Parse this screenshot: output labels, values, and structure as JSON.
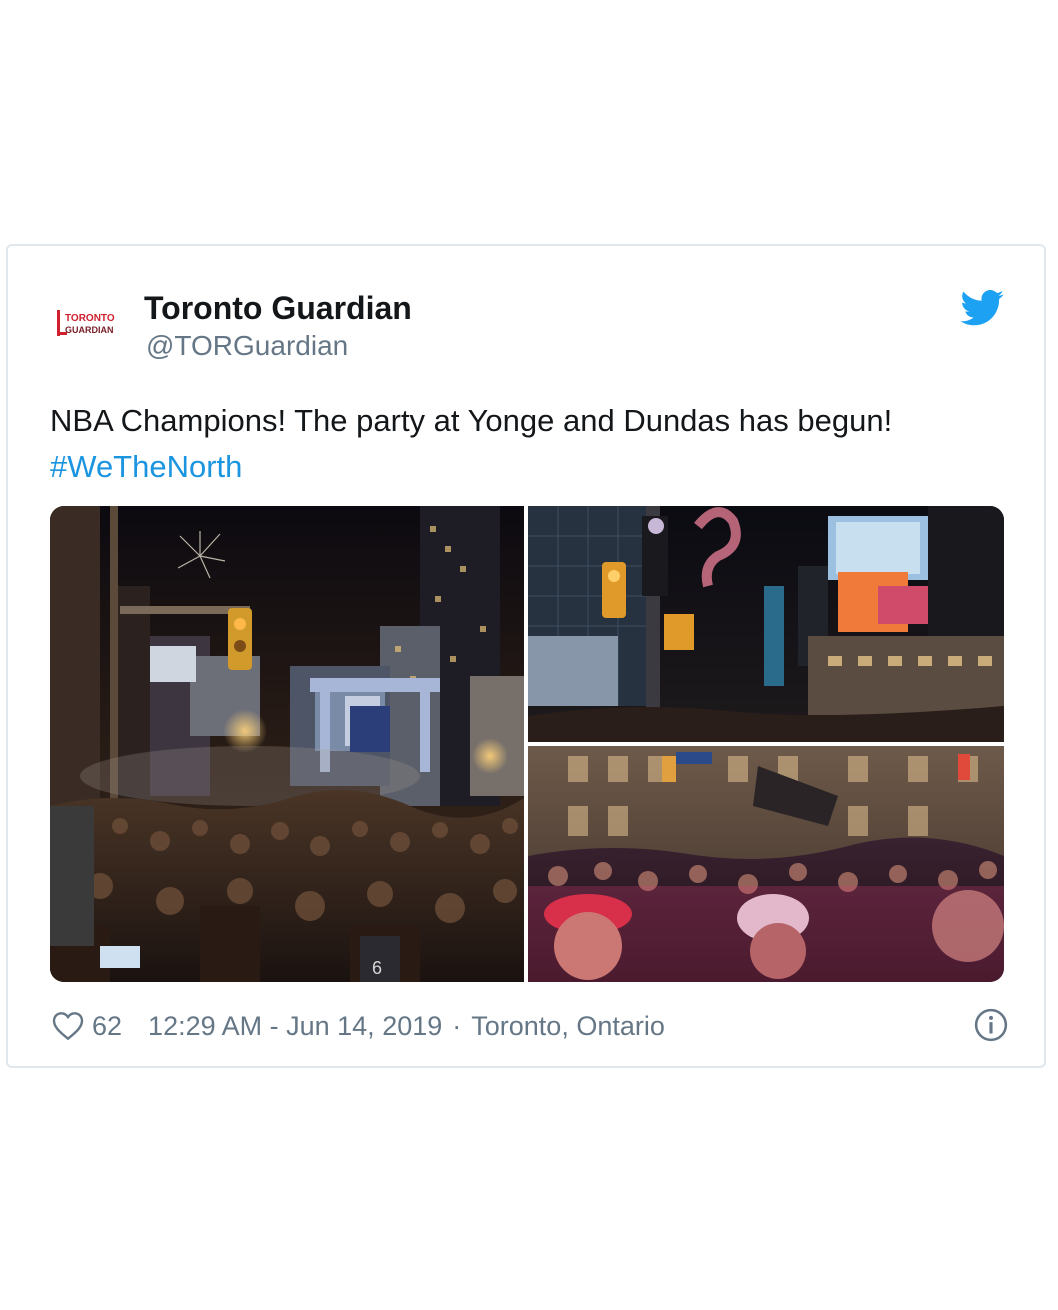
{
  "tweet": {
    "author": {
      "name": "Toronto Guardian",
      "handle": "@TORGuardian",
      "avatar_text_top": "TORONTO",
      "avatar_text_bottom": "GUARDIAN",
      "avatar_color": "#d0202e"
    },
    "text": "NBA Champions! The party at Yonge and Dundas has begun!",
    "hashtag": "#WeTheNorth",
    "media": [
      {
        "name": "photo-yonge-dundas-crowd-fireworks"
      },
      {
        "name": "photo-person-on-traffic-pole"
      },
      {
        "name": "photo-crowd-street-celebration"
      }
    ],
    "footer": {
      "like_count": "62",
      "time": "12:29 AM - Jun 14, 2019",
      "separator": "·",
      "location": "Toronto, Ontario"
    },
    "icons": {
      "bird": "twitter-bird-icon",
      "heart": "heart-icon",
      "info": "info-icon"
    },
    "colors": {
      "brand": "#1da1f2",
      "hashtag": "#1b95e0",
      "text": "#14171a",
      "secondary": "#657786",
      "border": "#e1e8ed"
    }
  }
}
